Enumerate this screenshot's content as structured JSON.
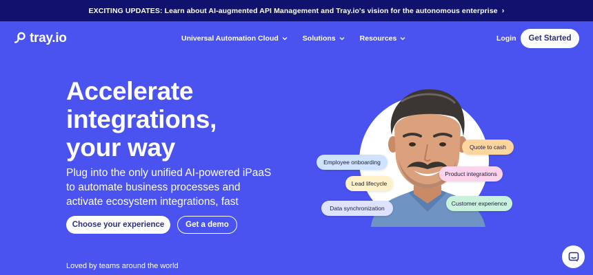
{
  "announcement": {
    "text": "EXCITING UPDATES: Learn about AI-augmented API Management and Tray.io's vision for the autonomous enterprise",
    "chevron": "›"
  },
  "brand": {
    "name": "tray.io",
    "icon": "tray-logo-icon"
  },
  "nav": {
    "items": [
      {
        "label": "Universal Automation Cloud"
      },
      {
        "label": "Solutions"
      },
      {
        "label": "Resources"
      }
    ],
    "login": "Login",
    "get_started": "Get Started"
  },
  "hero": {
    "title_lines": [
      "Accelerate",
      "integrations,",
      "your way"
    ],
    "subtitle_lines": [
      "Plug into the only unified AI-powered iPaaS",
      "to automate business processes and",
      "activate ecosystem integrations, fast"
    ],
    "primary_cta": "Choose your experience",
    "secondary_cta": "Get a demo"
  },
  "tags": [
    {
      "label": "Quote to cash",
      "color": "#ffd59e"
    },
    {
      "label": "Employee onboarding",
      "color": "#cfe2ff"
    },
    {
      "label": "Product integrations",
      "color": "#fbd3ec"
    },
    {
      "label": "Lead lifecycle",
      "color": "#fff1c9"
    },
    {
      "label": "Customer experience",
      "color": "#c9f2dd"
    },
    {
      "label": "Data synchronization",
      "color": "#dde3ff"
    }
  ],
  "social_proof": "Loved by teams around the world",
  "colors": {
    "background": "#4a53f0",
    "announcement_bar": "#10126e",
    "button_text": "#2b2f7a"
  },
  "chat": {
    "icon": "chat-icon"
  }
}
